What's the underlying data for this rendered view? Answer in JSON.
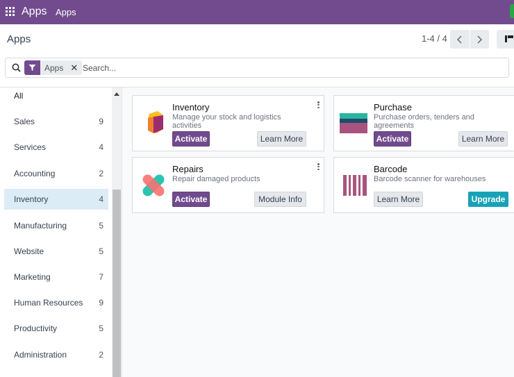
{
  "navbar": {
    "brand": "Apps",
    "menu_item": "Apps"
  },
  "control_panel": {
    "title": "Apps",
    "pager": "1-4 / 4"
  },
  "search": {
    "facet_value": "Apps",
    "placeholder": "Search..."
  },
  "sidebar": {
    "items": [
      {
        "label": "All",
        "count": ""
      },
      {
        "label": "Sales",
        "count": "9"
      },
      {
        "label": "Services",
        "count": "4"
      },
      {
        "label": "Accounting",
        "count": "2"
      },
      {
        "label": "Inventory",
        "count": "4"
      },
      {
        "label": "Manufacturing",
        "count": "5"
      },
      {
        "label": "Website",
        "count": "5"
      },
      {
        "label": "Marketing",
        "count": "7"
      },
      {
        "label": "Human Resources",
        "count": "9"
      },
      {
        "label": "Productivity",
        "count": "5"
      },
      {
        "label": "Administration",
        "count": "2"
      }
    ],
    "active": "Inventory"
  },
  "apps": [
    {
      "name": "Inventory",
      "description": "Manage your stock and logistics activities",
      "primary_button": "Activate",
      "secondary_button": "Learn More"
    },
    {
      "name": "Purchase",
      "description": "Purchase orders, tenders and agreements",
      "primary_button": "Activate",
      "secondary_button": "Learn More"
    },
    {
      "name": "Repairs",
      "description": "Repair damaged products",
      "primary_button": "Activate",
      "secondary_button": "Module Info"
    },
    {
      "name": "Barcode",
      "description": "Barcode scanner for warehouses",
      "primary_button": "Upgrade",
      "secondary_button": "Learn More"
    }
  ],
  "colors": {
    "brand": "#714b8e",
    "upgrade": "#17a2b8",
    "active_item": "#dcecf6"
  }
}
